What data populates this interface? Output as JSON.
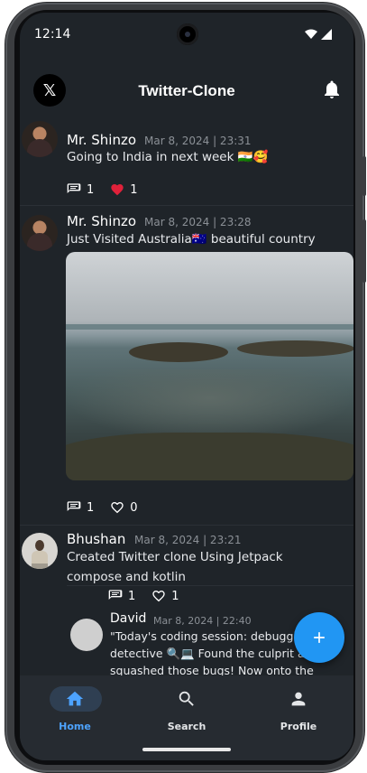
{
  "status": {
    "time": "12:14"
  },
  "app": {
    "title": "Twitter-Clone",
    "logo_glyph": "𝕏"
  },
  "posts": [
    {
      "name": "Mr. Shinzo",
      "date": "Mar 8, 2024 | 23:31",
      "text": "Going to India in next week 🇮🇳🥰",
      "comments": "1",
      "likes": "1",
      "liked": true
    },
    {
      "name": "Mr. Shinzo",
      "date": "Mar 8, 2024 | 23:28",
      "text": "Just Visited Australia🇦🇺 beautiful country",
      "comments": "1",
      "likes": "0",
      "liked": false
    },
    {
      "name": "Bhushan",
      "date": "Mar 8, 2024 | 23:21",
      "text": "Created Twitter clone Using Jetpack compose and kotlin",
      "comments": "1",
      "likes": "1",
      "liked": false
    }
  ],
  "reply": {
    "name": "David",
    "date": "Mar 8, 2024 | 22:40",
    "text": "\"Today's coding session: debugging detective 🔍💻 Found the culprit and squashed those bugs! Now onto the next"
  },
  "nav": [
    {
      "label": "Home",
      "icon": "home-icon",
      "active": true
    },
    {
      "label": "Search",
      "icon": "search-icon",
      "active": false
    },
    {
      "label": "Profile",
      "icon": "person-icon",
      "active": false
    }
  ],
  "colors": {
    "background": "#1f2429",
    "accent": "#2196f3",
    "like_red": "#e0213a",
    "nav_active": "#4da3ff"
  }
}
